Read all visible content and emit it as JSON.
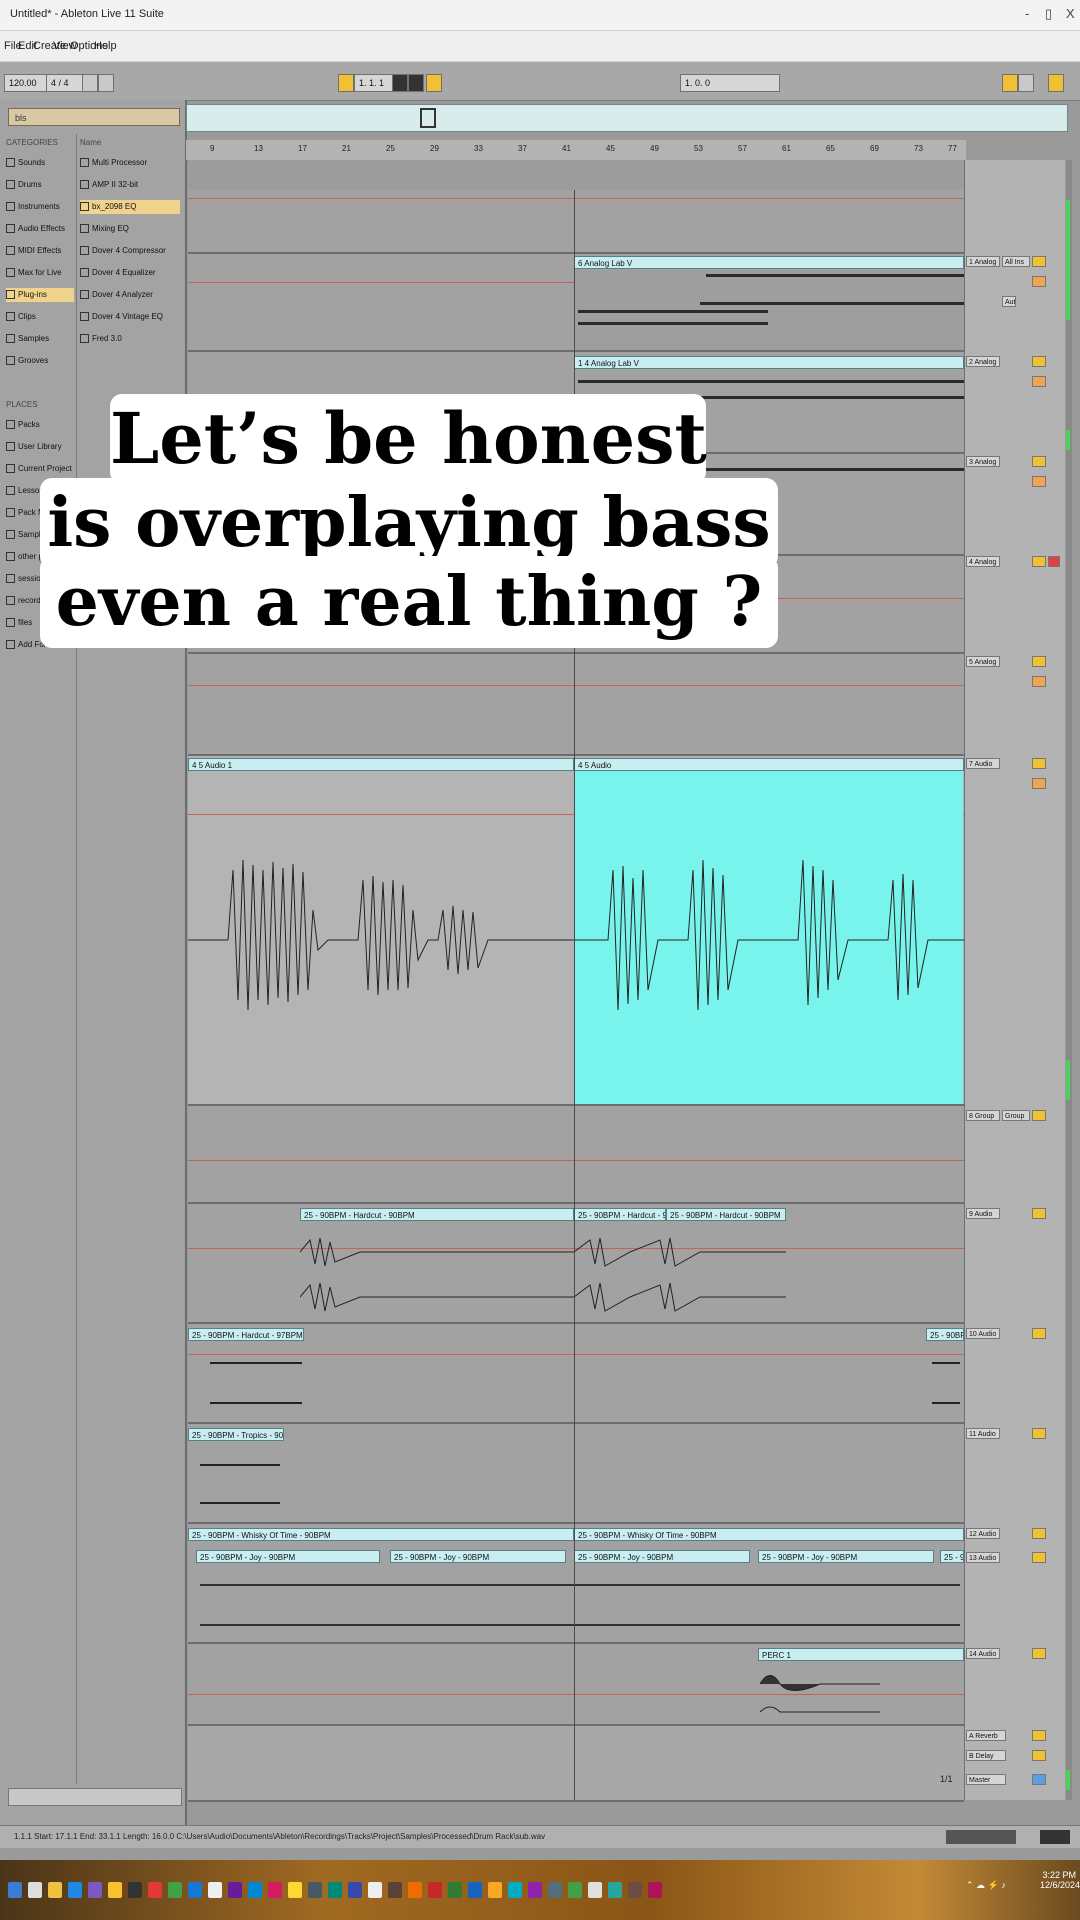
{
  "window": {
    "title": "Untitled* - Ableton Live 11 Suite",
    "controls": [
      "-",
      "▯",
      "X"
    ]
  },
  "menu": [
    "File",
    "Edit",
    "Create",
    "View",
    "Options",
    "Help"
  ],
  "transport": {
    "tempo": "120.00",
    "signature": "4 / 4",
    "position": "1. 1. 1",
    "loop_end": "1. 0. 0"
  },
  "browser": {
    "search_value": "bls",
    "categories_header": "CATEGORIES",
    "categories": [
      "Sounds",
      "Drums",
      "Instruments",
      "Audio Effects",
      "MIDI Effects",
      "Max for Live",
      "Plug-ins",
      "Clips",
      "Samples",
      "Grooves"
    ],
    "selected_category": "Plug-ins",
    "places_header": "PLACES",
    "places": [
      "Packs",
      "User Library",
      "Current Project",
      "Lessons",
      "Pack MP3",
      "Sample Pack",
      "other plugins",
      "sessions",
      "recordings",
      "files",
      "Add Folder..."
    ],
    "name_header": "Name",
    "items": [
      "Multi Processor",
      "AMP II 32-bit",
      "bx_2098 EQ",
      "Mixing EQ",
      "Dover 4 Compressor",
      "Dover 4 Equalizer",
      "Dover 4 Analyzer",
      "Dover 4 Vintage EQ",
      "Fred 3.0"
    ],
    "selected_item": "bx_2098 EQ"
  },
  "ruler": {
    "bars": [
      "9",
      "13",
      "17",
      "21",
      "25",
      "29",
      "33",
      "37",
      "41",
      "45",
      "49",
      "53",
      "57",
      "61",
      "65",
      "69",
      "73",
      "77"
    ]
  },
  "clips": {
    "analog1": "6 Analog Lab V",
    "analog2": "1 4 Analog Lab V",
    "audio_left": "4 5 Audio 1",
    "audio_right": "4 5 Audio",
    "drumclip1": "25 - 90BPM - Hardcut - 90BPM",
    "drumclip2": "25 - 90BPM - Hardcut - 90BPM",
    "drumclip3": "25 - 90BPM - Hardcut - 90BPM",
    "perc1": "25 - 90BPM - Hardcut - 97BPM",
    "perc1b": "25 - 90BPM - Hardcut - 97BPM",
    "perc2": "25 - 90BPM - Hardcut",
    "kick": "25 - 90BPM - Tropics - 90BPM",
    "long1": "25 - 90BPM - Whisky Of Time - 90BPM",
    "long2": "25 - 90BPM - Whisky Of Time - 90BPM",
    "seg1": "25 - 90BPM - Joy - 90BPM",
    "seg2": "25 - 90BPM - Joy - 90BPM",
    "seg3": "25 - 90BPM - Joy - 90BPM",
    "seg4": "25 - 90BPM - Joy - 90BPM",
    "seg5": "25 - 90BPM - Joy - 90BPM",
    "fx": "PERC 1"
  },
  "mixer": {
    "tracks": [
      "1 Analog",
      "2 Analog",
      "3 Analog",
      "4 Analog",
      "5 Analog",
      "7 Audio",
      "8 Group",
      "9 Audio",
      "10 Audio",
      "11 Audio",
      "12 Audio",
      "13 Audio",
      "14 Audio"
    ],
    "returns": [
      "A Reverb",
      "B Delay",
      "Master"
    ],
    "input_label": "All Ins",
    "monitor": "Auto",
    "group_label": "Group",
    "master_ratio": "1/1"
  },
  "caption": {
    "line1": "Let’s be honest",
    "line2": "is overplaying bass",
    "line3": "even a real thing ?"
  },
  "status": {
    "text": "1.1.1 Start: 17.1.1  End: 33.1.1  Length: 16.0.0  C:\\Users\\Audio\\Documents\\Ableton\\Recordings\\Tracks\\Project\\Samples\\Processed\\Drum Rack\\sub.wav"
  },
  "clock": {
    "time": "3:22 PM",
    "date": "12/6/2024"
  },
  "colors": {
    "clip": "#c9eef2",
    "selection": "#78f4ec",
    "accent_yellow": "#f2c033",
    "accent_orange": "#f1a354"
  }
}
